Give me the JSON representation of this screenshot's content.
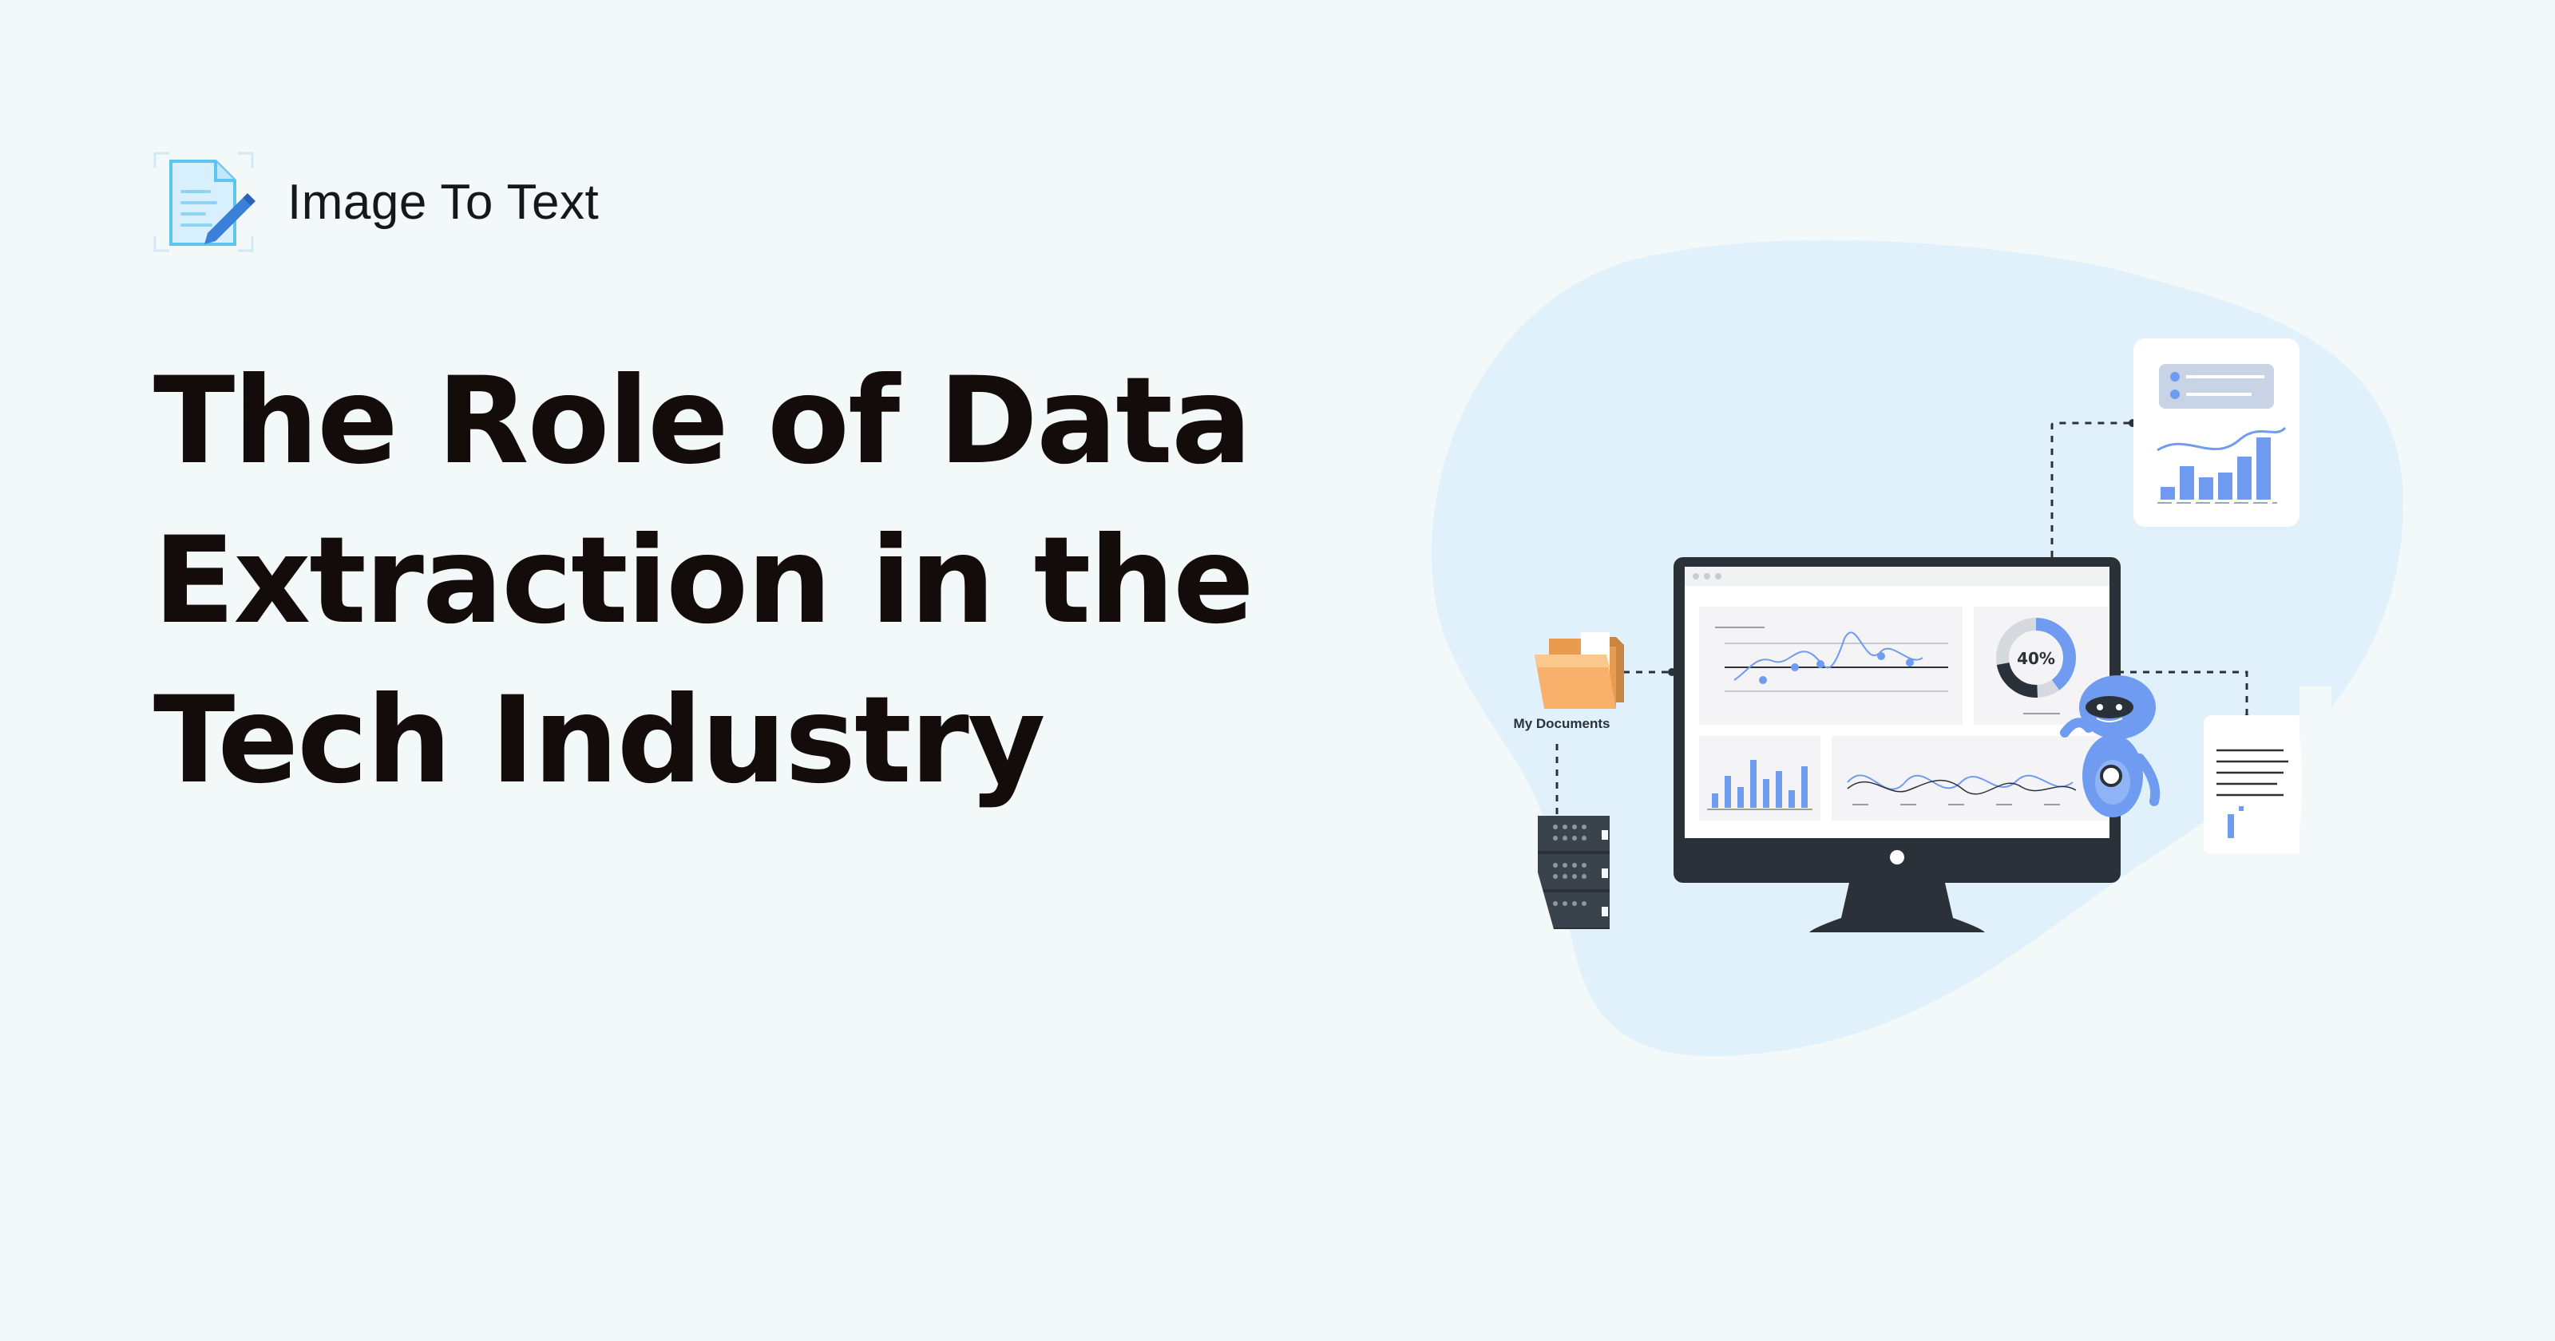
{
  "brand": {
    "name": "Image To Text",
    "logo_icon": "document-pen-icon"
  },
  "headline": "The Role of Data Extraction in the Tech Industry",
  "illustration": {
    "folder_label": "My Documents",
    "donut_label": "40%",
    "donut_value": 0.4,
    "icons": [
      "folder-icon",
      "server-rack-icon",
      "monitor-icon",
      "robot-icon",
      "report-card-icon",
      "document-icon"
    ]
  },
  "colors": {
    "background": "#f3f9f9",
    "blob": "#e0f1fc",
    "accent": "#6f9cf0",
    "dark": "#2b3138",
    "folder": "#f6a65b",
    "headline": "#140c0a"
  }
}
